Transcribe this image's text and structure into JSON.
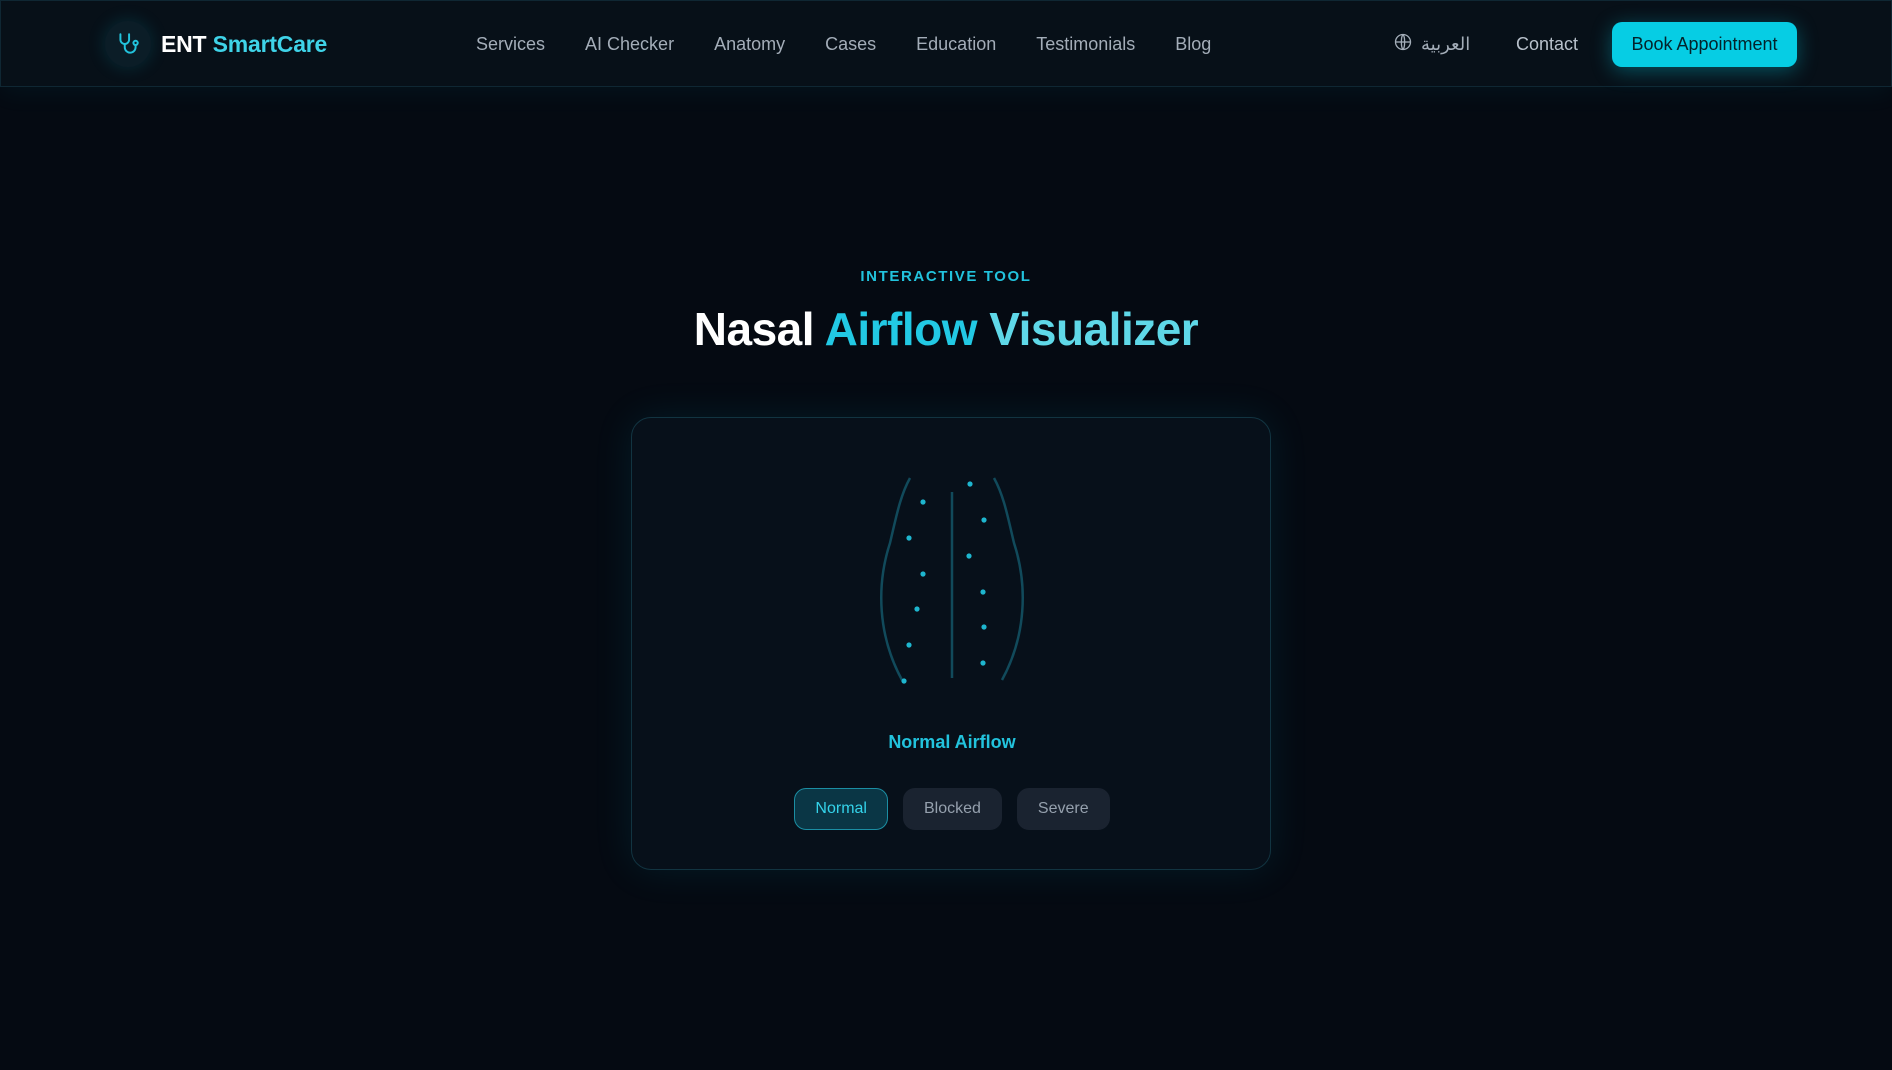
{
  "brand": {
    "name_part1": "ENT",
    "name_part2": "SmartCare",
    "icon": "stethoscope-icon"
  },
  "nav": {
    "links": [
      "Services",
      "AI Checker",
      "Anatomy",
      "Cases",
      "Education",
      "Testimonials",
      "Blog"
    ],
    "language_label": "العربية",
    "language_icon": "globe-icon",
    "contact_label": "Contact",
    "book_label": "Book Appointment"
  },
  "hero": {
    "eyebrow": "INTERACTIVE TOOL",
    "title_part1": "Nasal",
    "title_part2": "Airflow",
    "title_part3": "Visualizer"
  },
  "visualizer": {
    "status": "Normal Airflow",
    "modes": [
      "Normal",
      "Blocked",
      "Severe"
    ],
    "selected_mode": "Normal"
  },
  "colors": {
    "accent": "#06cde4",
    "background": "#050a12",
    "card": "#07101a"
  }
}
